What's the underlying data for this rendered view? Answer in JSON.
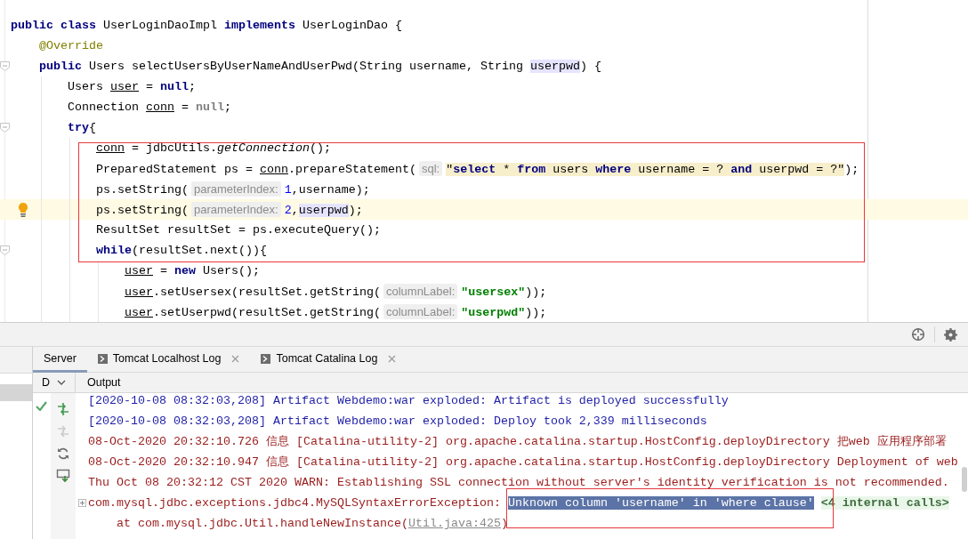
{
  "editor": {
    "lines": [
      {
        "current": false,
        "tokens": [
          {
            "kind": "keyword",
            "text": "public class"
          },
          {
            "kind": "plain",
            "text": " UserLoginDaoImpl "
          },
          {
            "kind": "keyword",
            "text": "implements"
          },
          {
            "kind": "plain",
            "text": " UserLoginDao {"
          }
        ],
        "children": [
          {
            "current": false,
            "tokens": [
              {
                "kind": "annotation",
                "text": "@Override"
              }
            ]
          },
          {
            "current": false,
            "tokens": [
              {
                "kind": "keyword",
                "text": "public"
              },
              {
                "kind": "plain",
                "text": " Users selectUsersByUserNameAndUserPwd(String username, String "
              },
              {
                "kind": "highlight",
                "text": "userpwd"
              },
              {
                "kind": "plain",
                "text": ") {"
              }
            ],
            "children": [
              {
                "current": false,
                "tokens": [
                  {
                    "kind": "plain",
                    "text": "Users "
                  },
                  {
                    "kind": "reassigned",
                    "text": "user"
                  },
                  {
                    "kind": "plain",
                    "text": " = "
                  },
                  {
                    "kind": "keyword",
                    "text": "null"
                  },
                  {
                    "kind": "plain",
                    "text": ";"
                  }
                ]
              },
              {
                "current": false,
                "tokens": [
                  {
                    "kind": "plain",
                    "text": "Connection "
                  },
                  {
                    "kind": "reassigned",
                    "text": "conn"
                  },
                  {
                    "kind": "plain",
                    "text": " = "
                  },
                  {
                    "kind": "unused",
                    "text": "null"
                  },
                  {
                    "kind": "plain",
                    "text": ";"
                  }
                ]
              },
              {
                "current": false,
                "tokens": [
                  {
                    "kind": "keyword",
                    "text": "try"
                  },
                  {
                    "kind": "plain",
                    "text": "{"
                  }
                ],
                "children": [
                  {
                    "current": false,
                    "tokens": [
                      {
                        "kind": "reassigned",
                        "text": "conn"
                      },
                      {
                        "kind": "plain",
                        "text": " = jdbcUtils."
                      },
                      {
                        "kind": "static",
                        "text": "getConnection"
                      },
                      {
                        "kind": "plain",
                        "text": "();"
                      }
                    ]
                  },
                  {
                    "current": false,
                    "tokens": [
                      {
                        "kind": "plain",
                        "text": "PreparedStatement ps = "
                      },
                      {
                        "kind": "reassigned",
                        "text": "conn"
                      },
                      {
                        "kind": "plain",
                        "text": ".prepareStatement("
                      },
                      {
                        "kind": "hint",
                        "text": "sql:"
                      },
                      {
                        "kind": "sql",
                        "text": "\""
                      },
                      {
                        "kind": "sql-keyword",
                        "text": "select"
                      },
                      {
                        "kind": "sql",
                        "text": " * "
                      },
                      {
                        "kind": "sql-keyword",
                        "text": "from"
                      },
                      {
                        "kind": "sql",
                        "text": " users "
                      },
                      {
                        "kind": "sql-keyword",
                        "text": "where"
                      },
                      {
                        "kind": "sql",
                        "text": " username = ? "
                      },
                      {
                        "kind": "sql-keyword",
                        "text": "and"
                      },
                      {
                        "kind": "sql",
                        "text": " userpwd = ?\""
                      },
                      {
                        "kind": "plain",
                        "text": ");"
                      }
                    ]
                  },
                  {
                    "current": false,
                    "tokens": [
                      {
                        "kind": "plain",
                        "text": "ps.setString("
                      },
                      {
                        "kind": "hint",
                        "text": "parameterIndex:"
                      },
                      {
                        "kind": "number",
                        "text": "1"
                      },
                      {
                        "kind": "plain",
                        "text": ",username);"
                      }
                    ]
                  },
                  {
                    "current": true,
                    "tokens": [
                      {
                        "kind": "plain",
                        "text": "ps.setString("
                      },
                      {
                        "kind": "hint",
                        "text": "parameterIndex:"
                      },
                      {
                        "kind": "number",
                        "text": "2"
                      },
                      {
                        "kind": "plain",
                        "text": ","
                      },
                      {
                        "kind": "highlight",
                        "text": "userpwd"
                      },
                      {
                        "kind": "plain",
                        "text": ");"
                      }
                    ]
                  },
                  {
                    "current": false,
                    "tokens": [
                      {
                        "kind": "plain",
                        "text": "ResultSet resultSet = ps.executeQuery();"
                      }
                    ]
                  },
                  {
                    "current": false,
                    "tokens": [
                      {
                        "kind": "keyword",
                        "text": "while"
                      },
                      {
                        "kind": "plain",
                        "text": "(resultSet.next()){"
                      }
                    ],
                    "children": [
                      {
                        "current": false,
                        "tokens": [
                          {
                            "kind": "reassigned",
                            "text": "user"
                          },
                          {
                            "kind": "plain",
                            "text": " = "
                          },
                          {
                            "kind": "keyword",
                            "text": "new"
                          },
                          {
                            "kind": "plain",
                            "text": " Users();"
                          }
                        ]
                      },
                      {
                        "current": false,
                        "tokens": [
                          {
                            "kind": "reassigned",
                            "text": "user"
                          },
                          {
                            "kind": "plain",
                            "text": ".setUsersex(resultSet.getString("
                          },
                          {
                            "kind": "hint",
                            "text": "columnLabel:"
                          },
                          {
                            "kind": "string",
                            "text": "\"usersex\""
                          },
                          {
                            "kind": "plain",
                            "text": "));"
                          }
                        ]
                      },
                      {
                        "current": false,
                        "tokens": [
                          {
                            "kind": "reassigned",
                            "text": "user"
                          },
                          {
                            "kind": "plain",
                            "text": ".setUserpwd(resultSet.getString("
                          },
                          {
                            "kind": "hint",
                            "text": "columnLabel:"
                          },
                          {
                            "kind": "string",
                            "text": "\"userpwd\""
                          },
                          {
                            "kind": "plain",
                            "text": "));"
                          }
                        ]
                      }
                    ]
                  }
                ]
              }
            ]
          }
        ]
      }
    ]
  },
  "tool_window": {
    "tabs": [
      {
        "label": "Server",
        "kind": "server",
        "selected": true,
        "closable": false
      },
      {
        "label": "Tomcat Localhost Log",
        "kind": "log",
        "selected": false,
        "closable": true
      },
      {
        "label": "Tomcat Catalina Log",
        "kind": "log",
        "selected": false,
        "closable": true
      }
    ],
    "services_header": "D",
    "actions": [
      {
        "kind": "deploy",
        "disabled": false
      },
      {
        "kind": "undeploy",
        "disabled": true
      },
      {
        "kind": "refresh",
        "disabled": false
      },
      {
        "kind": "dump",
        "disabled": false
      }
    ],
    "output_header": "Output",
    "log": [
      {
        "kind": "info",
        "expandable": false,
        "segments": [
          {
            "kind": "text",
            "text": "[2020-10-08 08:32:03,208] Artifact Webdemo:war exploded: Artifact is deployed successfully"
          }
        ]
      },
      {
        "kind": "info",
        "expandable": false,
        "segments": [
          {
            "kind": "text",
            "text": "[2020-10-08 08:32:03,208] Artifact Webdemo:war exploded: Deploy took 2,339 milliseconds"
          }
        ]
      },
      {
        "kind": "error",
        "expandable": false,
        "segments": [
          {
            "kind": "text",
            "text": "08-Oct-2020 20:32:10.726 信息 [Catalina-utility-2] org.apache.catalina.startup.HostConfig.deployDirectory 把web 应用程序部署"
          }
        ]
      },
      {
        "kind": "error",
        "expandable": false,
        "segments": [
          {
            "kind": "text",
            "text": "08-Oct-2020 20:32:10.947 信息 [Catalina-utility-2] org.apache.catalina.startup.HostConfig.deployDirectory Deployment of web"
          }
        ]
      },
      {
        "kind": "error",
        "expandable": false,
        "segments": [
          {
            "kind": "text",
            "text": "Thu Oct 08 20:32:12 CST 2020 WARN: Establishing SSL connection without server's identity verification is not recommended."
          }
        ]
      },
      {
        "kind": "error",
        "expandable": true,
        "segments": [
          {
            "kind": "text",
            "text": "com.mysql.jdbc.exceptions.jdbc4.MySQLSyntaxErrorException: "
          },
          {
            "kind": "selected",
            "text": "Unknown column 'username' in 'where clause'"
          },
          {
            "kind": "folded",
            "text": "<4 internal calls>"
          }
        ]
      },
      {
        "kind": "frame",
        "expandable": false,
        "segments": [
          {
            "kind": "text",
            "text": "at com.mysql.jdbc.Util.handleNewInstance("
          },
          {
            "kind": "link",
            "text": "Util.java:425"
          },
          {
            "kind": "text",
            "text": ")"
          }
        ]
      }
    ]
  }
}
